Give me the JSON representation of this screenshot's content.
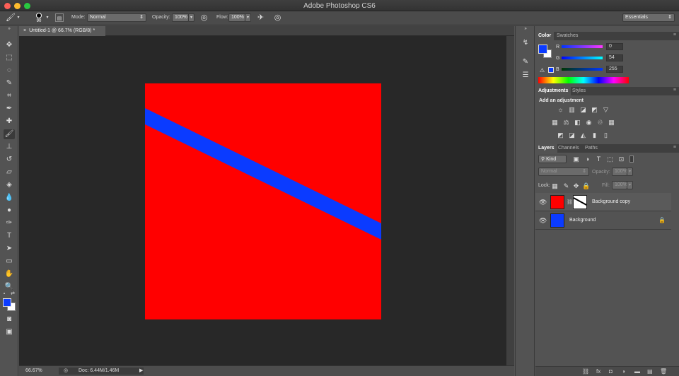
{
  "app": {
    "title": "Adobe Photoshop CS6"
  },
  "options": {
    "brush_size": "90",
    "mode_label": "Mode:",
    "mode_value": "Normal",
    "opacity_label": "Opacity:",
    "opacity_value": "100%",
    "flow_label": "Flow:",
    "flow_value": "100%",
    "workspace": "Essentials"
  },
  "document": {
    "tab_title": "Untitled-1 @ 66.7% (RGB/8) *",
    "canvas_color": "#ff0000",
    "stripe_color": "#0b3bff"
  },
  "status": {
    "zoom": "66.67%",
    "doc_info": "Doc: 6.44M/1.46M"
  },
  "colors": {
    "foreground": "#0b3bff",
    "background": "#ffffff"
  },
  "color_panel": {
    "tabs": [
      "Color",
      "Swatches"
    ],
    "r_label": "R",
    "g_label": "G",
    "b_label": "B",
    "r_value": "0",
    "g_value": "54",
    "b_value": "255"
  },
  "adjustments_panel": {
    "tabs": [
      "Adjustments",
      "Styles"
    ],
    "heading": "Add an adjustment"
  },
  "layers_panel": {
    "tabs": [
      "Layers",
      "Channels",
      "Paths"
    ],
    "kind_filter": "Kind",
    "blend_mode": "Normal",
    "opacity_label": "Opacity:",
    "opacity_value": "100%",
    "lock_label": "Lock:",
    "fill_label": "Fill:",
    "fill_value": "100%",
    "layers": [
      {
        "name": "Background copy",
        "thumb_color": "#ff0000",
        "has_mask": true,
        "locked": false,
        "selected": true
      },
      {
        "name": "Background",
        "thumb_color": "#0b3bff",
        "has_mask": false,
        "locked": true,
        "selected": false
      }
    ]
  }
}
